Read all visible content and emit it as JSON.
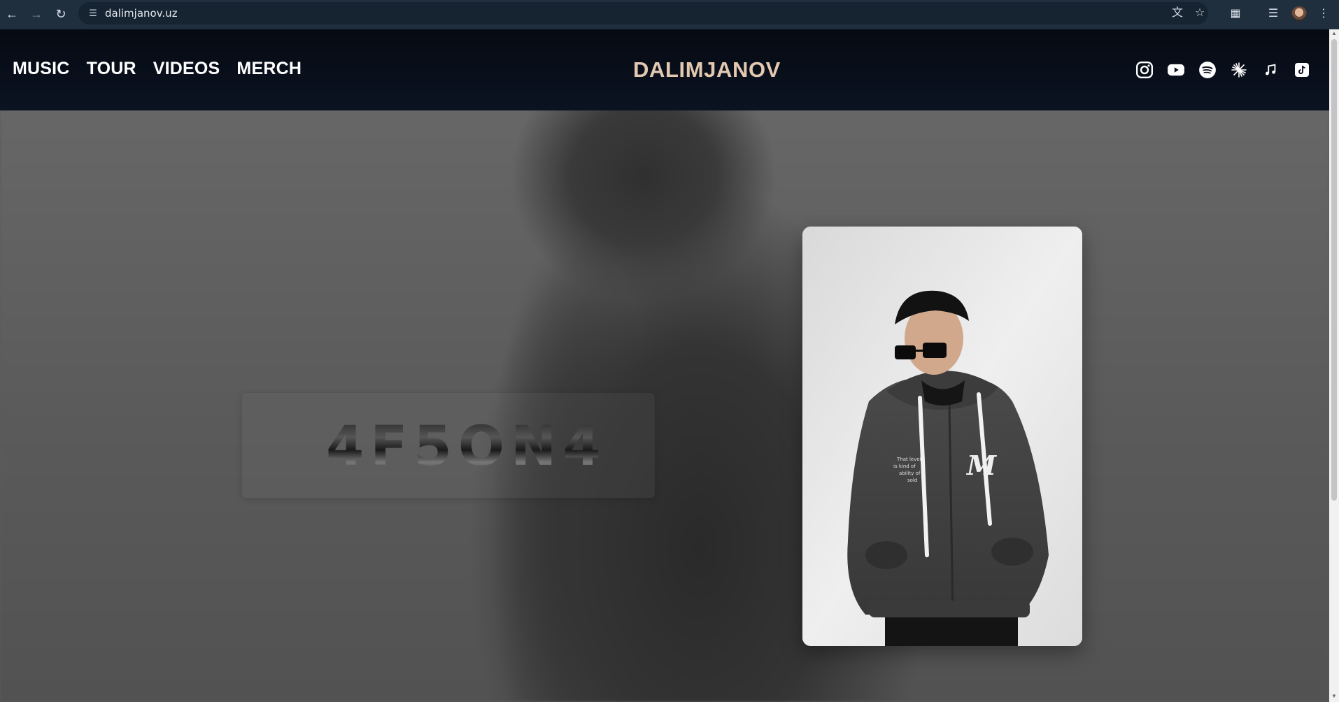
{
  "browser": {
    "url": "dalimjanov.uz",
    "back_icon": "arrow-left-icon",
    "forward_icon": "arrow-right-icon",
    "reload_icon": "reload-icon",
    "site_info_icon": "tune-icon",
    "translate_icon": "translate-icon",
    "bookmark_icon": "star-icon",
    "extensions_icon": "puzzle-icon",
    "media_icon": "queue-music-icon",
    "profile_icon": "avatar",
    "menu_icon": "kebab-menu-icon"
  },
  "site": {
    "nav": [
      {
        "label": "MUSIC"
      },
      {
        "label": "TOUR"
      },
      {
        "label": "VIDEOS"
      },
      {
        "label": "MERCH"
      }
    ],
    "logo": "DALIMJANOV",
    "socials": [
      {
        "icon": "instagram-icon"
      },
      {
        "icon": "youtube-icon"
      },
      {
        "icon": "spotify-icon"
      },
      {
        "icon": "starburst-icon"
      },
      {
        "icon": "music-note-icon"
      },
      {
        "icon": "tiktok-icon"
      }
    ],
    "colors": {
      "header_bg": "#070c16",
      "logo": "#e3c9b0",
      "nav_text": "#ffffff"
    }
  },
  "hero": {
    "album_title": "4F5ON4",
    "photo_text": "That level... is kind of... ability of... sold"
  }
}
